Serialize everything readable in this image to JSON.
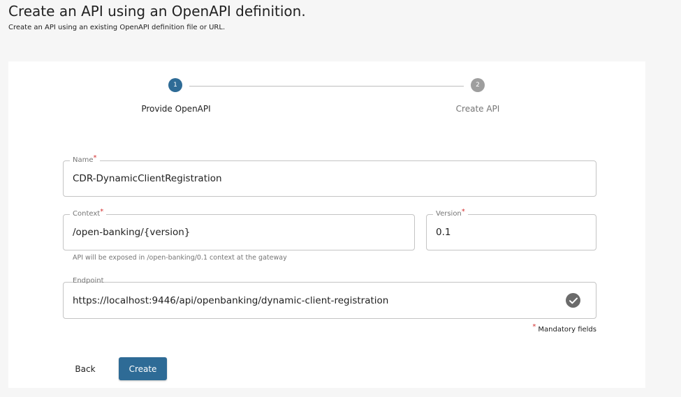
{
  "header": {
    "title": "Create an API using an OpenAPI definition.",
    "subtitle": "Create an API using an existing OpenAPI definition file or URL."
  },
  "stepper": {
    "steps": [
      {
        "number": "1",
        "label": "Provide OpenAPI",
        "state": "active"
      },
      {
        "number": "2",
        "label": "Create API",
        "state": "inactive"
      }
    ]
  },
  "form": {
    "name": {
      "label": "Name",
      "required_mark": "*",
      "value": "CDR-DynamicClientRegistration"
    },
    "context": {
      "label": "Context",
      "required_mark": "*",
      "value": "/open-banking/{version}",
      "helper": "API will be exposed in /open-banking/0.1 context at the gateway"
    },
    "version": {
      "label": "Version",
      "required_mark": "*",
      "value": "0.1"
    },
    "endpoint": {
      "label": "Endpoint",
      "value": "https://localhost:9446/api/openbanking/dynamic-client-registration",
      "status_icon": "check-circle-icon"
    },
    "mandatory_note": {
      "mark": "*",
      "text": "Mandatory fields"
    }
  },
  "actions": {
    "back_label": "Back",
    "create_label": "Create"
  },
  "colors": {
    "primary": "#2e6b96",
    "inactive_step": "#9e9e9e",
    "required": "#d32f2f"
  }
}
